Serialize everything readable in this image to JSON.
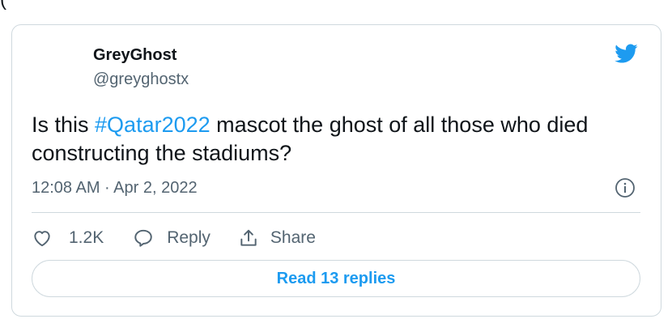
{
  "top_fragment": "(",
  "tweet": {
    "author": {
      "display_name": "GreyGhost",
      "handle": "@greyghostx"
    },
    "text_before": "Is this ",
    "hashtag": "#Qatar2022",
    "text_after": " mascot the ghost of all those who died constructing the stadiums?",
    "timestamp": "12:08 AM · Apr 2, 2022",
    "actions": {
      "like_count": "1.2K",
      "reply_label": "Reply",
      "share_label": "Share"
    },
    "read_replies_label": "Read 13 replies"
  },
  "icons": {
    "brand": "twitter-bird-icon",
    "info": "info-icon",
    "like": "heart-icon",
    "reply": "reply-bubble-icon",
    "share": "share-icon"
  },
  "colors": {
    "accent": "#1d9bf0",
    "text": "#0f1419",
    "secondary": "#536471",
    "border": "#cfd9de"
  }
}
